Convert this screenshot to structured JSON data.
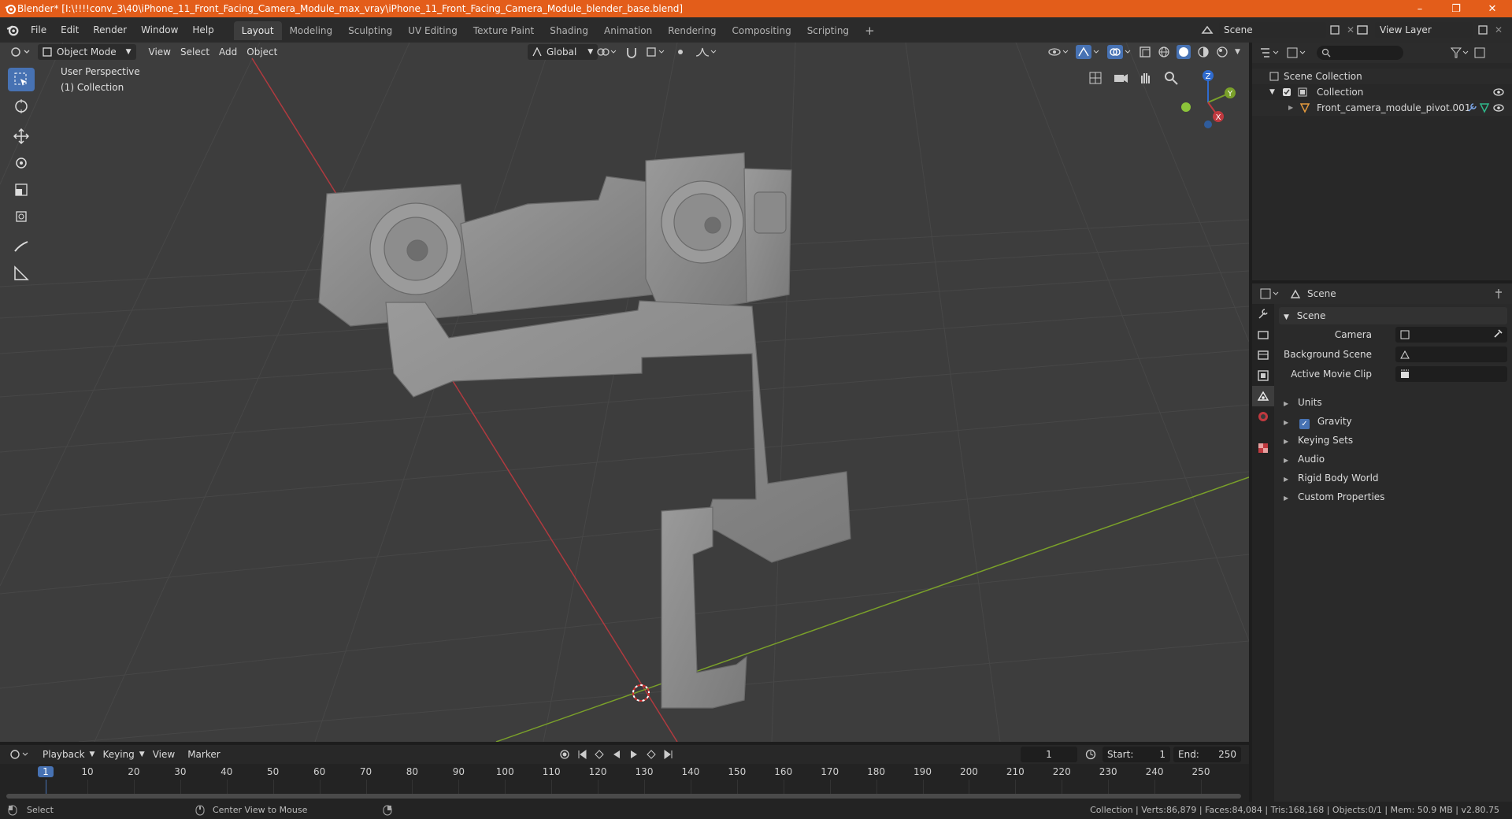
{
  "window": {
    "title": "Blender* [I:\\!!!!conv_3\\40\\iPhone_11_Front_Facing_Camera_Module_max_vray\\iPhone_11_Front_Facing_Camera_Module_blender_base.blend]",
    "minimize": "–",
    "restore": "❐",
    "close": "✕"
  },
  "menus": [
    "File",
    "Edit",
    "Render",
    "Window",
    "Help"
  ],
  "workspaces": [
    "Layout",
    "Modeling",
    "Sculpting",
    "UV Editing",
    "Texture Paint",
    "Shading",
    "Animation",
    "Rendering",
    "Compositing",
    "Scripting"
  ],
  "active_workspace": "Layout",
  "add_workspace": "+",
  "scene_field": "Scene",
  "view_layer_field": "View Layer",
  "viewport": {
    "mode": "Object Mode",
    "menus": [
      "View",
      "Select",
      "Add",
      "Object"
    ],
    "orientation": "Global",
    "overlay_line1": "User Perspective",
    "overlay_line2": "(1) Collection",
    "gizmo": {
      "z": "Z",
      "y": "Y",
      "x": "X"
    }
  },
  "outliner": {
    "search_placeholder": "",
    "root": "Scene Collection",
    "collection": "Collection",
    "object": "Front_camera_module_pivot.001"
  },
  "properties": {
    "header": "Scene",
    "panel_title": "Scene",
    "camera_label": "Camera",
    "background_scene_label": "Background Scene",
    "active_movie_clip_label": "Active Movie Clip",
    "sections": [
      "Units",
      "Gravity",
      "Keying Sets",
      "Audio",
      "Rigid Body World",
      "Custom Properties"
    ],
    "gravity_checked": true
  },
  "timeline": {
    "menus": [
      "Playback",
      "Keying",
      "View",
      "Marker"
    ],
    "current_frame": "1",
    "start_label": "Start:",
    "start_value": "1",
    "end_label": "End:",
    "end_value": "250",
    "ticks": [
      "1",
      "10",
      "20",
      "30",
      "40",
      "50",
      "60",
      "70",
      "80",
      "90",
      "100",
      "110",
      "120",
      "130",
      "140",
      "150",
      "160",
      "170",
      "180",
      "190",
      "200",
      "210",
      "220",
      "230",
      "240",
      "250"
    ]
  },
  "status": {
    "left_action": "Select",
    "mid_action": "Center View to Mouse",
    "stats": "Collection | Verts:86,879 | Faces:84,084 | Tris:168,168 | Objects:0/1 | Mem: 50.9 MB | v2.80.75"
  },
  "colors": {
    "accent": "#4772b3",
    "titlebar": "#e35d1a",
    "x_axis": "#c0393f",
    "y_axis": "#7ea42a",
    "z_axis": "#2f6bcf",
    "model": "#8c8c8c"
  }
}
